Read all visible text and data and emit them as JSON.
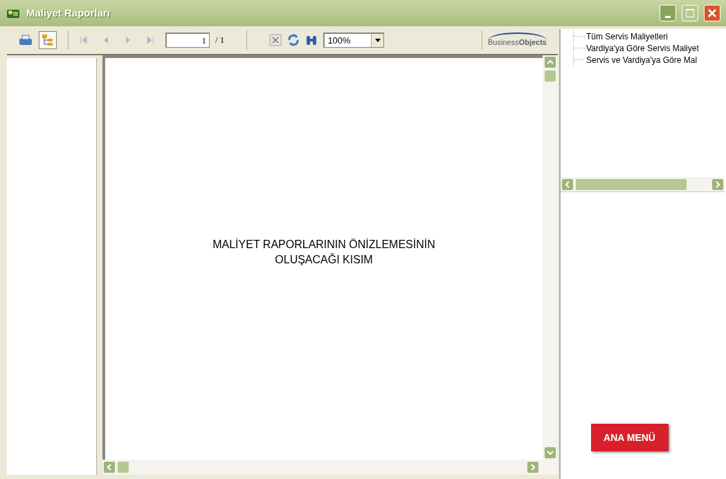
{
  "window": {
    "title": "Maliyet Raporları"
  },
  "toolbar": {
    "tree_toggle_on": true,
    "page_field": "1",
    "page_total": "/ 1",
    "zoom": "100%",
    "logo": "Business**Objects**"
  },
  "preview": {
    "lines": [
      "MALİYET RAPORLARININ ÖNİZLEMESİNİN",
      "OLUŞACAĞI KISIM"
    ]
  },
  "report_tree": {
    "items": [
      {
        "label": "Tüm Servis Maliyetleri"
      },
      {
        "label": "Vardiya'ya Göre Servis Maliyet"
      },
      {
        "label": "Servis ve Vardiya'ya Göre Mal"
      }
    ]
  },
  "main_menu_button": {
    "label": "ANA MENÜ"
  }
}
